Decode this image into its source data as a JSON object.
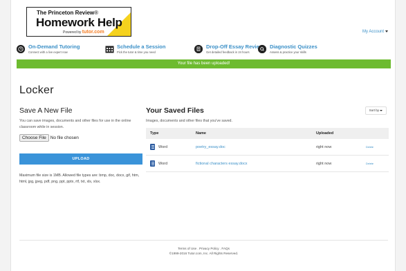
{
  "header": {
    "logo": {
      "line1_brand": "The Princeton Review",
      "line1_suffix": "®",
      "line2": "Homework Help",
      "line3_prefix": "Powered by",
      "line3_brand": "tutor.com"
    },
    "account_label": "My Account"
  },
  "nav": [
    {
      "title": "On-Demand Tutoring",
      "subtitle": "Connect with a live expert now",
      "icon": "clock-icon"
    },
    {
      "title": "Schedule a Session",
      "subtitle": "Pick the tutor & time you need",
      "icon": "calendar-icon"
    },
    {
      "title": "Drop-Off Essay Review",
      "subtitle": "Get detailed feedback in 24 hours",
      "icon": "document-icon"
    },
    {
      "title": "Diagnostic Quizzes",
      "subtitle": "Assess & practice your skills",
      "icon": "quiz-icon"
    }
  ],
  "banner": {
    "text": "Your file has been uploaded!",
    "color": "#6dbb2f"
  },
  "locker": {
    "title": "Locker",
    "save": {
      "title": "Save A New File",
      "description": "You can save images, documents and other files for use in the online classroom while in session.",
      "choose_button": "Choose File",
      "no_file": "No file chosen",
      "upload_button": "UPLOAD",
      "max_text": "Maximum file size is 1MB. Allowed file types are: bmp, doc, docx, gif, htm, html, jpg, jpeg, pdf, png, ppt, pptx, rtf, txt, xls, xlsx."
    },
    "saved": {
      "title": "Your Saved Files",
      "description": "Images, documents and other files that you've saved.",
      "sort_label": "Sort by",
      "columns": [
        "Type",
        "Name",
        "Uploaded"
      ],
      "rows": [
        {
          "type": "Word",
          "name": "poetry_essay.doc",
          "uploaded": "right now",
          "action": "Delete"
        },
        {
          "type": "Word",
          "name": "fictional characters essay.docx",
          "uploaded": "right now",
          "action": "Delete"
        }
      ]
    }
  },
  "footer": {
    "link_terms": "Terms of Use",
    "link_privacy": "Privacy Policy",
    "link_faqs": "FAQs",
    "sep": " . ",
    "copyright": "©1999-2016 Tutor.com, Inc. All Rights Reserved."
  },
  "colors": {
    "accent": "#3a8fc7",
    "upload_button": "#3a93d9",
    "logo_yellow": "#f5d21e"
  }
}
